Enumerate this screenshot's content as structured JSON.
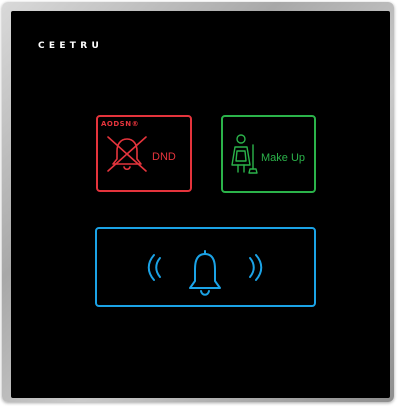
{
  "device": {
    "brand": "CEETRU",
    "buttons": {
      "dnd": {
        "logo_text": "AODSN®",
        "label": "DND",
        "color": "#e5343c"
      },
      "make_up": {
        "label": "Make Up",
        "color": "#2bb34a"
      },
      "doorbell": {
        "color": "#1ba3e6"
      }
    }
  }
}
